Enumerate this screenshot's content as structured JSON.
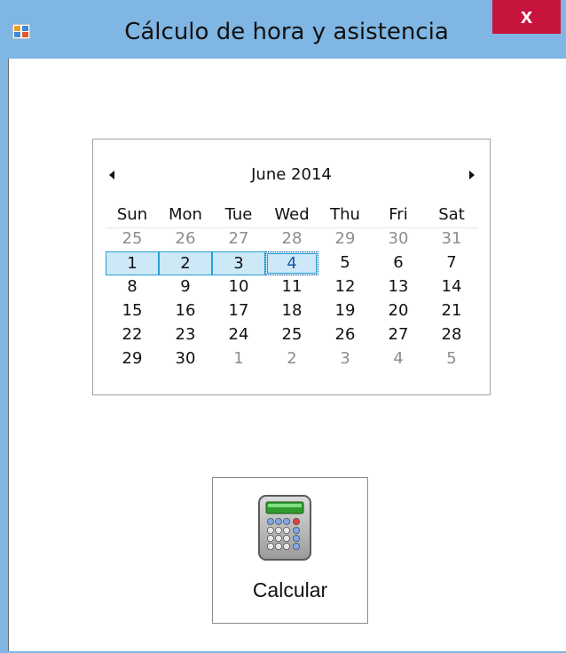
{
  "window": {
    "title": "Cálculo de hora y asistencia",
    "close_label": "x"
  },
  "calendar": {
    "month_label": "June 2014",
    "weekdays": [
      "Sun",
      "Mon",
      "Tue",
      "Wed",
      "Thu",
      "Fri",
      "Sat"
    ],
    "weeks": [
      [
        {
          "d": "25",
          "other": true
        },
        {
          "d": "26",
          "other": true
        },
        {
          "d": "27",
          "other": true
        },
        {
          "d": "28",
          "other": true
        },
        {
          "d": "29",
          "other": true
        },
        {
          "d": "30",
          "other": true
        },
        {
          "d": "31",
          "other": true
        }
      ],
      [
        {
          "d": "1",
          "selected": true
        },
        {
          "d": "2",
          "selected": true
        },
        {
          "d": "3",
          "selected": true
        },
        {
          "d": "4",
          "selected": true,
          "today": true
        },
        {
          "d": "5"
        },
        {
          "d": "6"
        },
        {
          "d": "7"
        }
      ],
      [
        {
          "d": "8"
        },
        {
          "d": "9"
        },
        {
          "d": "10"
        },
        {
          "d": "11"
        },
        {
          "d": "12"
        },
        {
          "d": "13"
        },
        {
          "d": "14"
        }
      ],
      [
        {
          "d": "15"
        },
        {
          "d": "16"
        },
        {
          "d": "17"
        },
        {
          "d": "18"
        },
        {
          "d": "19"
        },
        {
          "d": "20"
        },
        {
          "d": "21"
        }
      ],
      [
        {
          "d": "22"
        },
        {
          "d": "23"
        },
        {
          "d": "24"
        },
        {
          "d": "25"
        },
        {
          "d": "26"
        },
        {
          "d": "27"
        },
        {
          "d": "28"
        }
      ],
      [
        {
          "d": "29"
        },
        {
          "d": "30"
        },
        {
          "d": "1",
          "other": true
        },
        {
          "d": "2",
          "other": true
        },
        {
          "d": "3",
          "other": true
        },
        {
          "d": "4",
          "other": true
        },
        {
          "d": "5",
          "other": true
        }
      ]
    ]
  },
  "calc_button": {
    "label": "Calcular",
    "icon": "calculator-icon"
  },
  "colors": {
    "titlebar": "#7fb6e3",
    "close_button": "#c7143c",
    "selection": "#cde8f7",
    "selection_border": "#26a0da",
    "other_month_text": "#8d8d8d"
  }
}
